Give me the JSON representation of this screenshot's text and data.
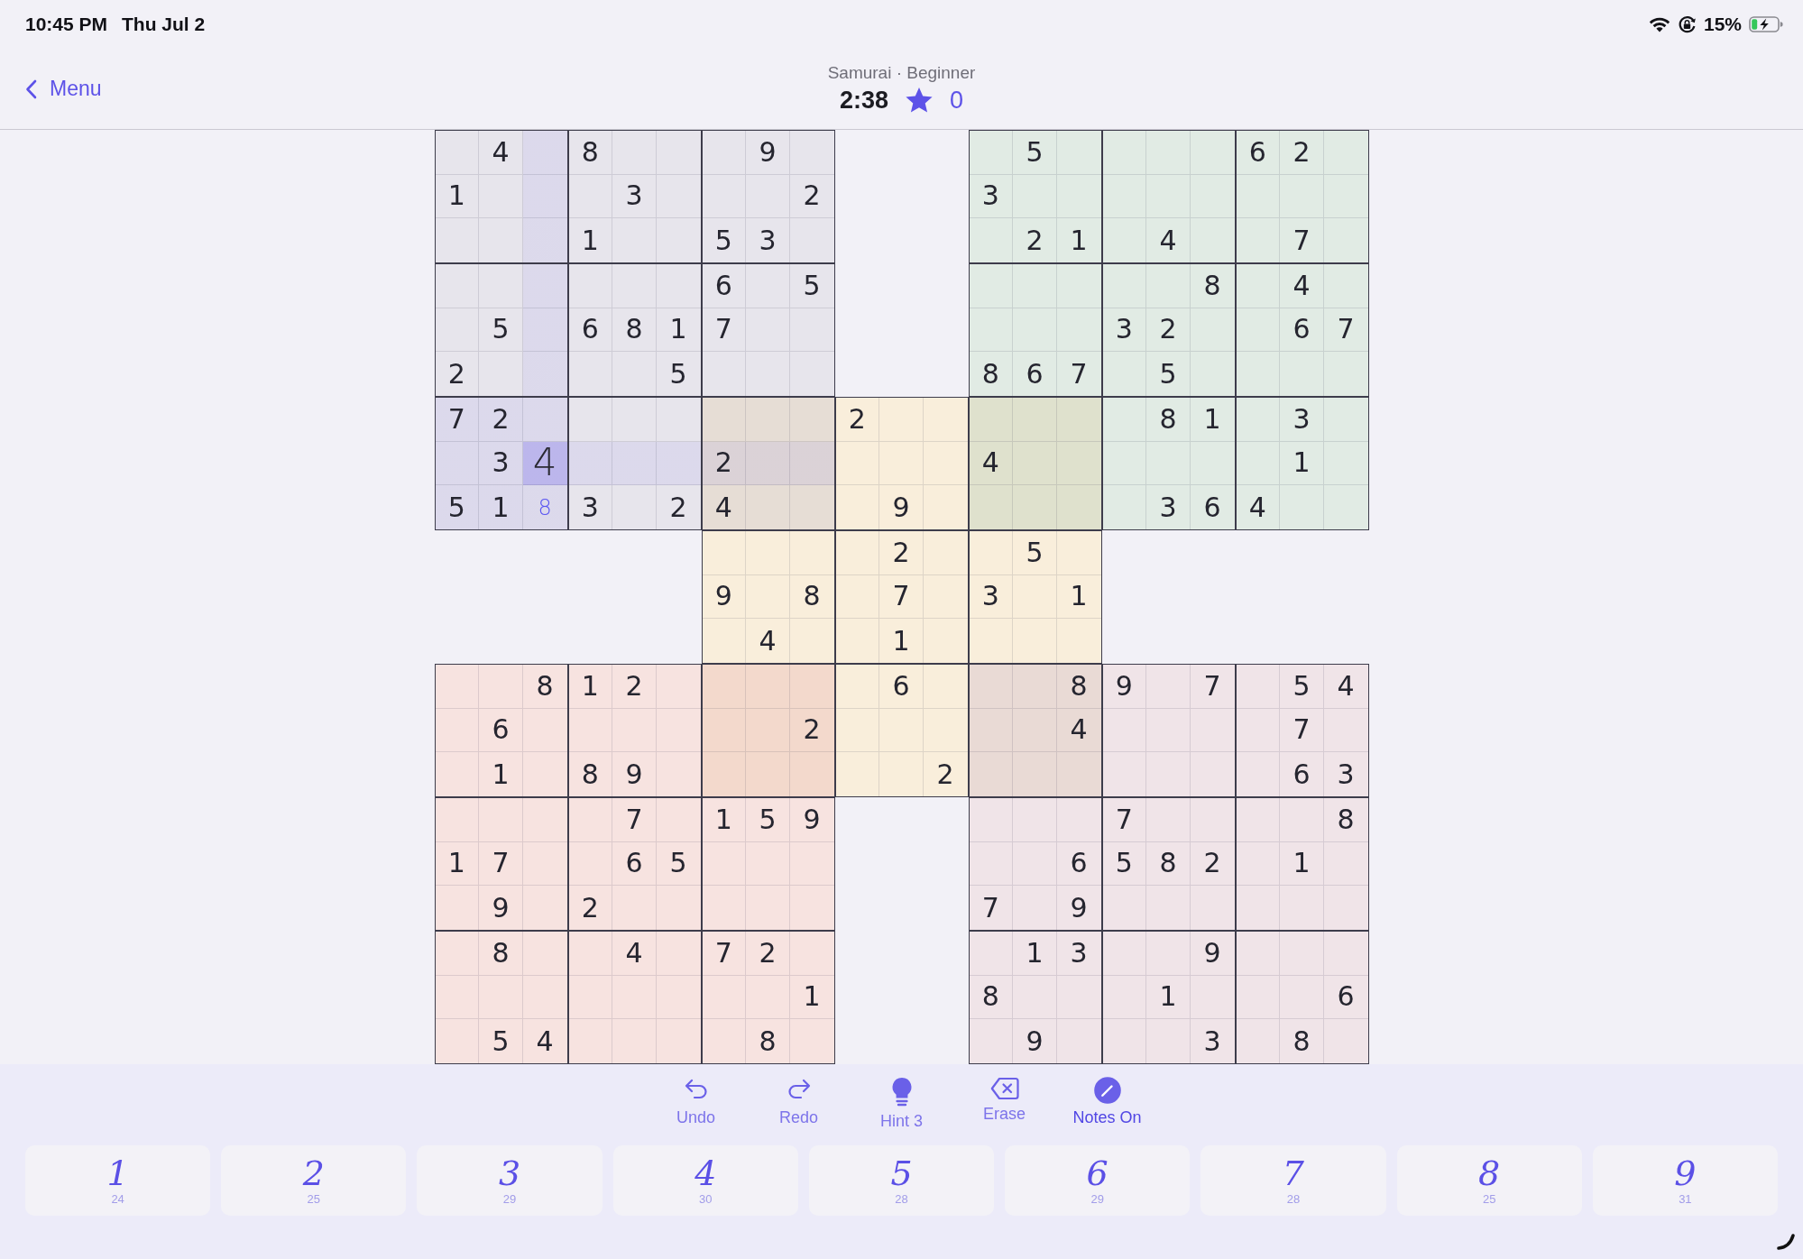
{
  "status_bar": {
    "time": "10:45 PM",
    "date": "Thu Jul 2",
    "battery": "15%"
  },
  "nav": {
    "back_label": "Menu",
    "subtitle": "Samurai · Beginner",
    "timer": "2:38",
    "score": "0"
  },
  "board": {
    "rows": [
      [
        "",
        "4",
        "",
        "8",
        "",
        "",
        "",
        "9",
        "",
        null,
        null,
        null,
        "",
        "5",
        "",
        "",
        "",
        "",
        "6",
        "2",
        ""
      ],
      [
        "1",
        "",
        "",
        "",
        "3",
        "",
        "",
        "",
        "2",
        null,
        null,
        null,
        "3",
        "",
        "",
        "",
        "",
        "",
        "",
        "",
        ""
      ],
      [
        "",
        "",
        "",
        "1",
        "",
        "",
        "5",
        "3",
        "",
        null,
        null,
        null,
        "",
        "2",
        "1",
        "",
        "4",
        "",
        "",
        "7",
        ""
      ],
      [
        "",
        "",
        "",
        "",
        "",
        "",
        "6",
        "",
        "5",
        null,
        null,
        null,
        "",
        "",
        "",
        "",
        "",
        "8",
        "",
        "4",
        ""
      ],
      [
        "",
        "5",
        "",
        "6",
        "8",
        "1",
        "7",
        "",
        "",
        null,
        null,
        null,
        "",
        "",
        "",
        "3",
        "2",
        "",
        "",
        "6",
        "7"
      ],
      [
        "2",
        "",
        "",
        "",
        "",
        "5",
        "",
        "",
        "",
        null,
        null,
        null,
        "8",
        "6",
        "7",
        "",
        "5",
        "",
        "",
        "",
        ""
      ],
      [
        "7",
        "2",
        "",
        "",
        "",
        "",
        "",
        "",
        "",
        "2",
        "",
        "",
        "",
        "",
        "",
        "",
        "8",
        "1",
        "",
        "3",
        ""
      ],
      [
        "",
        "3",
        {
          "kind": "ink",
          "value": "4",
          "selected": true
        },
        "",
        "",
        "",
        "2",
        "",
        "",
        "",
        "",
        "",
        "4",
        "",
        "",
        "",
        "",
        "",
        "",
        "1",
        ""
      ],
      [
        "5",
        "1",
        {
          "kind": "entered",
          "value": "8",
          "selected": false
        },
        "3",
        "",
        "2",
        "4",
        "",
        "",
        "",
        "9",
        "",
        "",
        "",
        "",
        "",
        "3",
        "6",
        "4",
        "",
        ""
      ],
      [
        null,
        null,
        null,
        null,
        null,
        null,
        "",
        "",
        "",
        "",
        "2",
        "",
        "",
        "5",
        "",
        null,
        null,
        null,
        null,
        null,
        null
      ],
      [
        null,
        null,
        null,
        null,
        null,
        null,
        "9",
        "",
        "8",
        "",
        "7",
        "",
        "3",
        "",
        "1",
        null,
        null,
        null,
        null,
        null,
        null
      ],
      [
        null,
        null,
        null,
        null,
        null,
        null,
        "",
        "4",
        "",
        "",
        "1",
        "",
        "",
        "",
        "",
        null,
        null,
        null,
        null,
        null,
        null
      ],
      [
        "",
        "",
        "8",
        "1",
        "2",
        "",
        "",
        "",
        "",
        "",
        "6",
        "",
        "",
        "",
        "8",
        "9",
        "",
        "7",
        "",
        "5",
        "4"
      ],
      [
        "",
        "6",
        "",
        "",
        "",
        "",
        "",
        "",
        "2",
        "",
        "",
        "",
        "",
        "",
        "4",
        "",
        "",
        "",
        "",
        "7",
        ""
      ],
      [
        "",
        "1",
        "",
        "8",
        "9",
        "",
        "",
        "",
        "",
        "",
        "",
        "2",
        "",
        "",
        "",
        "",
        "",
        "",
        "",
        "6",
        "3"
      ],
      [
        "",
        "",
        "",
        "",
        "7",
        "",
        "1",
        "5",
        "9",
        null,
        null,
        null,
        "",
        "",
        "",
        "7",
        "",
        "",
        "",
        "",
        "8"
      ],
      [
        "1",
        "7",
        "",
        "",
        "6",
        "5",
        "",
        "",
        "",
        null,
        null,
        null,
        "",
        "",
        "6",
        "5",
        "8",
        "2",
        "",
        "1",
        ""
      ],
      [
        "",
        "9",
        "",
        "2",
        "",
        "",
        "",
        "",
        "",
        null,
        null,
        null,
        "7",
        "",
        "9",
        "",
        "",
        "",
        "",
        "",
        ""
      ],
      [
        "",
        "8",
        "",
        "",
        "4",
        "",
        "7",
        "2",
        "",
        null,
        null,
        null,
        "",
        "1",
        "3",
        "",
        "",
        "9",
        "",
        "",
        ""
      ],
      [
        "",
        "",
        "",
        "",
        "",
        "",
        "",
        "",
        "1",
        null,
        null,
        null,
        "8",
        "",
        "",
        "",
        "1",
        "",
        "",
        "",
        "6"
      ],
      [
        "",
        "5",
        "4",
        "",
        "",
        "",
        "",
        "8",
        "",
        null,
        null,
        null,
        "",
        "9",
        "",
        "",
        "",
        "3",
        "",
        "8",
        ""
      ]
    ]
  },
  "toolbar": [
    {
      "kind": "undo",
      "label": "Undo",
      "active": false
    },
    {
      "kind": "redo",
      "label": "Redo",
      "active": false
    },
    {
      "kind": "hint",
      "label": "Hint 3",
      "active": false
    },
    {
      "kind": "erase",
      "label": "Erase",
      "active": false
    },
    {
      "kind": "notes",
      "label": "Notes On",
      "active": true
    }
  ],
  "number_pad": [
    {
      "digit": "1",
      "count": "24"
    },
    {
      "digit": "2",
      "count": "25"
    },
    {
      "digit": "3",
      "count": "29"
    },
    {
      "digit": "4",
      "count": "30"
    },
    {
      "digit": "5",
      "count": "28"
    },
    {
      "digit": "6",
      "count": "29"
    },
    {
      "digit": "7",
      "count": "28"
    },
    {
      "digit": "8",
      "count": "25"
    },
    {
      "digit": "9",
      "count": "31"
    }
  ]
}
